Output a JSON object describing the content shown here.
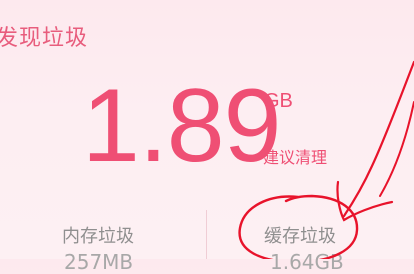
{
  "header": {
    "title": "发现垃圾"
  },
  "summary": {
    "total_value": "1.89",
    "unit": "GB",
    "clean_label": "建议清理"
  },
  "stats": {
    "memory": {
      "label": "内存垃圾",
      "value": "257MB"
    },
    "cache": {
      "label": "缓存垃圾",
      "value": "1.64GB"
    }
  },
  "colors": {
    "accent": "#ef4f74",
    "annotation": "#e8132b",
    "background": "#fdeef2"
  },
  "annotation": {
    "shape": "hand-drawn circle and arrow pointing to cache-junk"
  }
}
